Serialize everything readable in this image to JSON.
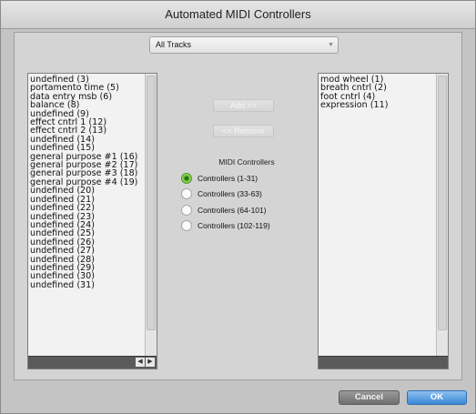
{
  "window": {
    "title": "Automated MIDI Controllers"
  },
  "track_select": {
    "value": "All Tracks"
  },
  "available_list": {
    "items": [
      "undefined (3)",
      "portamento time (5)",
      "data entry msb (6)",
      "balance (8)",
      "undefined (9)",
      "effect cntrl 1 (12)",
      "effect cntrl 2 (13)",
      "undefined (14)",
      "undefined (15)",
      "general purpose #1 (16)",
      "general purpose #2 (17)",
      "general purpose #3 (18)",
      "general purpose #4 (19)",
      "undefined (20)",
      "undefined (21)",
      "undefined (22)",
      "undefined (23)",
      "undefined (24)",
      "undefined (25)",
      "undefined (26)",
      "undefined (27)",
      "undefined (28)",
      "undefined (29)",
      "undefined (30)",
      "undefined (31)"
    ]
  },
  "automated_list": {
    "items": [
      "mod wheel (1)",
      "breath cntrl (2)",
      "foot cntrl (4)",
      "expression (11)"
    ]
  },
  "buttons": {
    "add_label": "Add >>",
    "remove_label": "<< Remove",
    "cancel_label": "Cancel",
    "ok_label": "OK"
  },
  "controllers_group": {
    "title": "MIDI Controllers",
    "options": [
      {
        "label": "Controllers (1-31)",
        "checked": true
      },
      {
        "label": "Controllers (33-63)",
        "checked": false
      },
      {
        "label": "Controllers (64-101)",
        "checked": false
      },
      {
        "label": "Controllers (102-119)",
        "checked": false
      }
    ]
  },
  "colors": {
    "ok_button": "#3c88d8",
    "selected_radio": "#6fcc3a"
  }
}
